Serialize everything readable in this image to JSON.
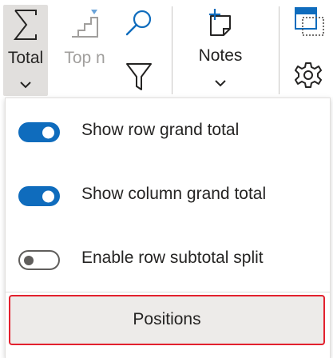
{
  "toolbar": {
    "total": {
      "label": "Total",
      "icon": "sigma-icon",
      "active": true
    },
    "top_n": {
      "label": "Top n",
      "icon": "top-n-icon",
      "disabled": true
    },
    "search": {
      "icon": "search-icon"
    },
    "filter": {
      "icon": "filter-icon"
    },
    "notes": {
      "label": "Notes",
      "icon": "notes-icon"
    },
    "format": {
      "icon": "format-icon"
    },
    "settings": {
      "icon": "gear-icon"
    }
  },
  "dropdown": {
    "toggles": [
      {
        "label": "Show row grand total",
        "on": true
      },
      {
        "label": "Show column grand total",
        "on": true
      },
      {
        "label": "Enable row subtotal split",
        "on": false
      }
    ],
    "positions_label": "Positions"
  },
  "colors": {
    "accent": "#0f6cbd",
    "highlight_border": "#e3212e",
    "active_button_bg": "#e1dfdd",
    "disabled_text": "#a19f9d"
  }
}
